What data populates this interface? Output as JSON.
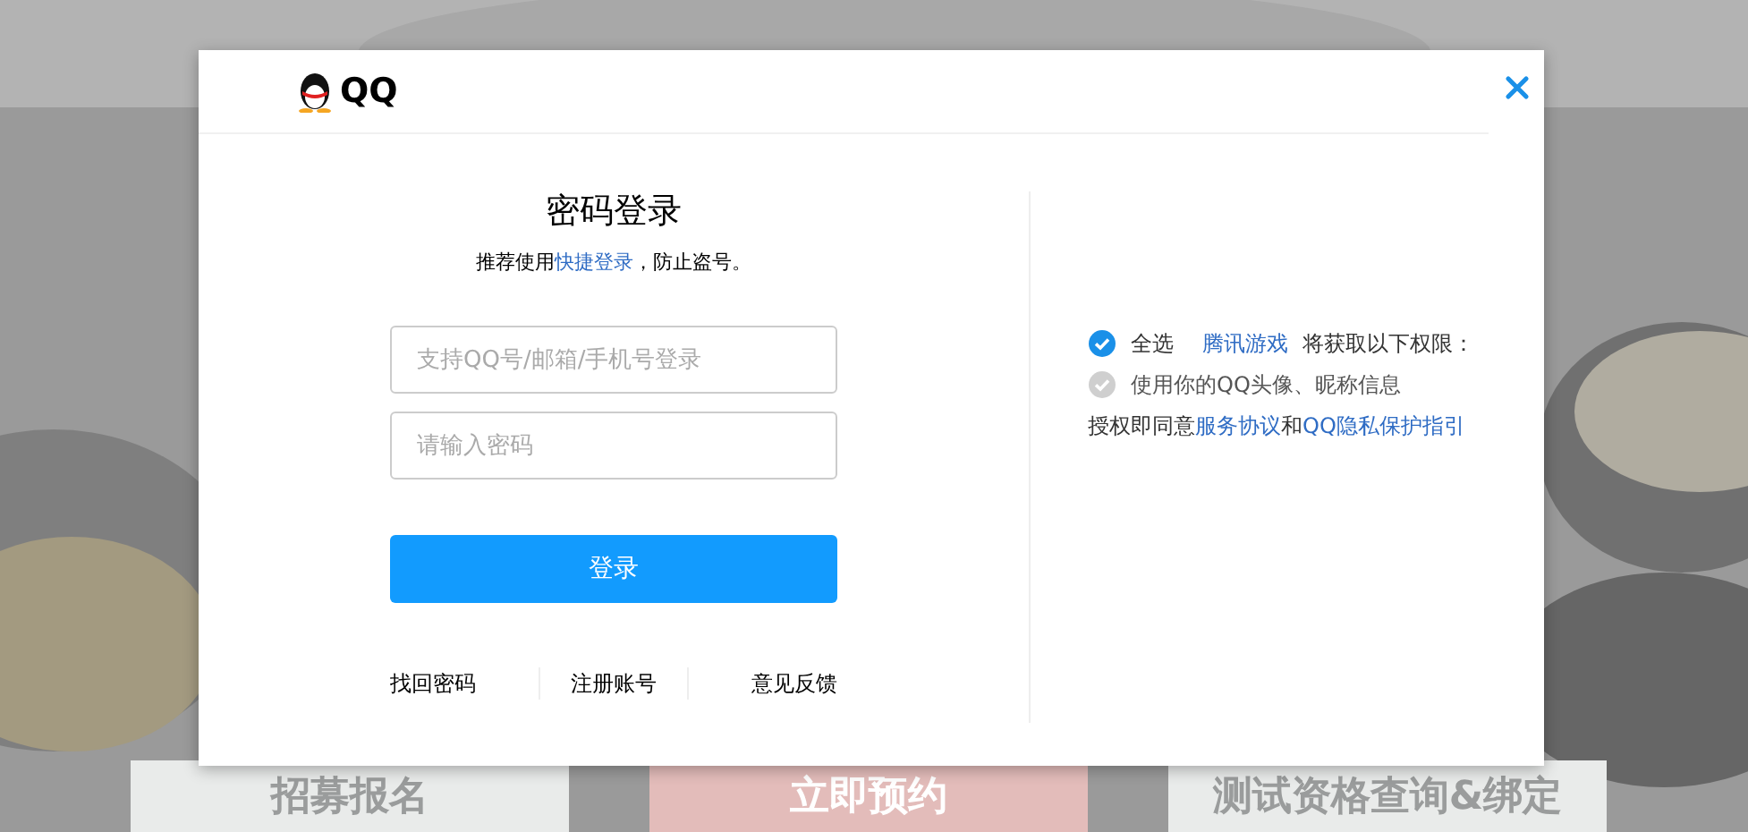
{
  "logo": {
    "text": "QQ"
  },
  "login": {
    "title": "密码登录",
    "hint_before": "推荐使用",
    "hint_link": "快捷登录",
    "hint_after": "，防止盗号。",
    "account": {
      "placeholder": "支持QQ号/邮箱/手机号登录"
    },
    "password": {
      "placeholder": "请输入密码"
    },
    "submit": "登录",
    "links": [
      "找回密码",
      "注册账号",
      "意见反馈"
    ]
  },
  "permissions": {
    "select_all": {
      "label": "全选",
      "checked": true
    },
    "app": "腾讯游戏",
    "suffix": "将获取以下权限：",
    "items": [
      {
        "label": "使用你的QQ头像、昵称信息",
        "checked": true,
        "disabled": true
      }
    ],
    "agreement": {
      "before": "授权即同意",
      "link1": "服务协议",
      "middle": "和",
      "link2": "QQ隐私保护指引"
    }
  },
  "page_tabs": [
    {
      "label": "招募报名",
      "selected": false
    },
    {
      "label": "立即预约",
      "selected": true
    },
    {
      "label": "测试资格查询&绑定",
      "selected": false
    }
  ]
}
